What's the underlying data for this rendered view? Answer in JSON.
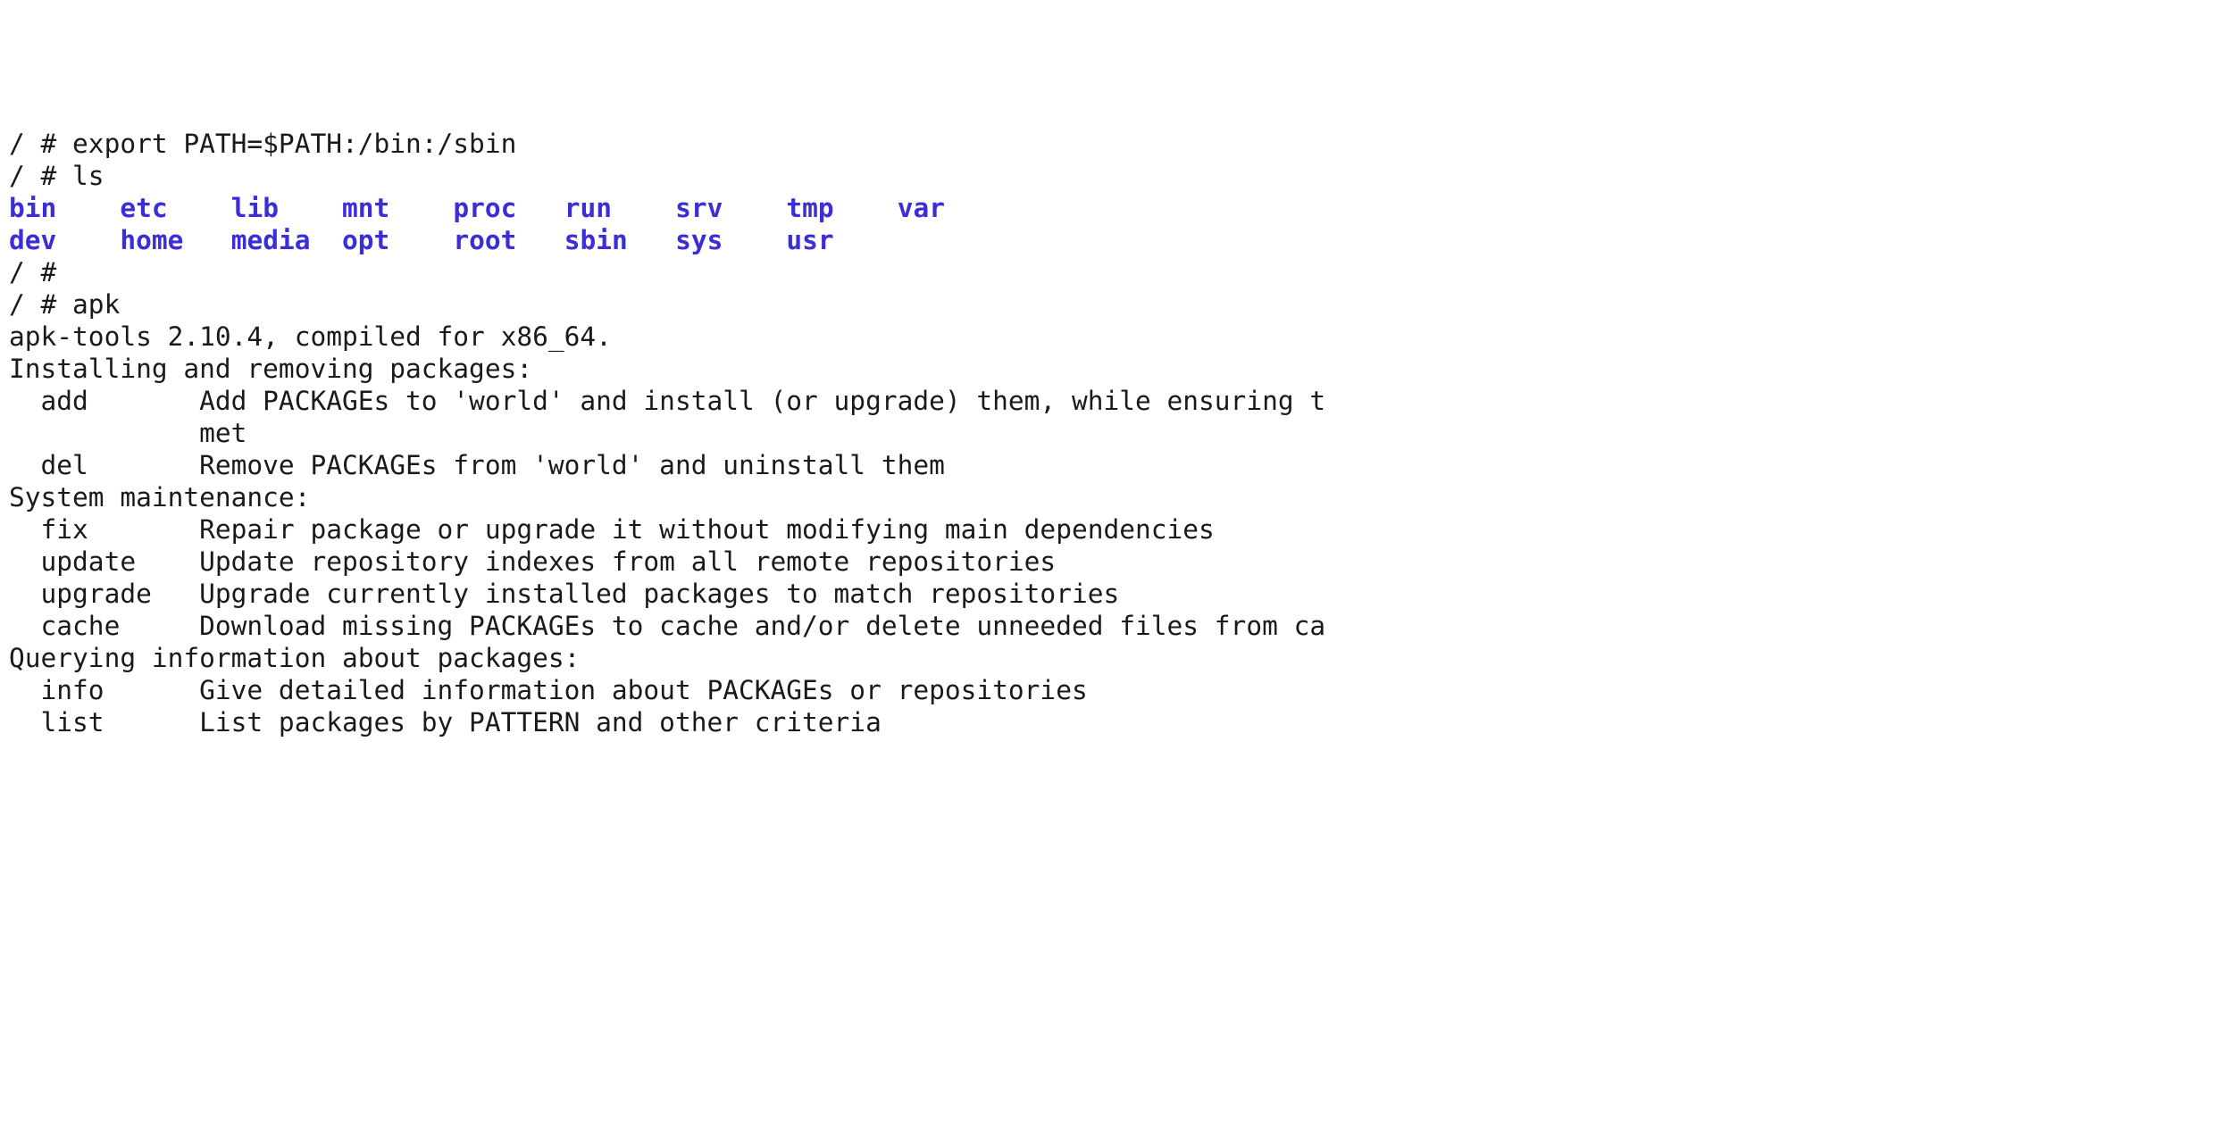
{
  "terminal": {
    "prompt_lines": {
      "export": "/ # export PATH=$PATH:/bin:/sbin",
      "ls": "/ # ls",
      "empty": "/ # ",
      "apk": "/ # apk",
      "blank": ""
    },
    "ls_output": {
      "row1": [
        {
          "name": "bin",
          "pad": "    "
        },
        {
          "name": "etc",
          "pad": "    "
        },
        {
          "name": "lib",
          "pad": "    "
        },
        {
          "name": "mnt",
          "pad": "    "
        },
        {
          "name": "proc",
          "pad": "   "
        },
        {
          "name": "run",
          "pad": "    "
        },
        {
          "name": "srv",
          "pad": "    "
        },
        {
          "name": "tmp",
          "pad": "    "
        },
        {
          "name": "var",
          "pad": ""
        }
      ],
      "row2": [
        {
          "name": "dev",
          "pad": "    "
        },
        {
          "name": "home",
          "pad": "   "
        },
        {
          "name": "media",
          "pad": "  "
        },
        {
          "name": "opt",
          "pad": "    "
        },
        {
          "name": "root",
          "pad": "   "
        },
        {
          "name": "sbin",
          "pad": "   "
        },
        {
          "name": "sys",
          "pad": "    "
        },
        {
          "name": "usr",
          "pad": ""
        }
      ]
    },
    "apk_output": {
      "version": "apk-tools 2.10.4, compiled for x86_64.",
      "section_install": "Installing and removing packages:",
      "add_line": "  add       Add PACKAGEs to 'world' and install (or upgrade) them, while ensuring t",
      "add_cont": "            met",
      "del_line": "  del       Remove PACKAGEs from 'world' and uninstall them",
      "section_system": "System maintenance:",
      "fix_line": "  fix       Repair package or upgrade it without modifying main dependencies",
      "update_line": "  update    Update repository indexes from all remote repositories",
      "upgrade_line": "  upgrade   Upgrade currently installed packages to match repositories",
      "cache_line": "  cache     Download missing PACKAGEs to cache and/or delete unneeded files from ca",
      "section_query": "Querying information about packages:",
      "info_line": "  info      Give detailed information about PACKAGEs or repositories",
      "list_line": "  list      List packages by PATTERN and other criteria"
    }
  }
}
